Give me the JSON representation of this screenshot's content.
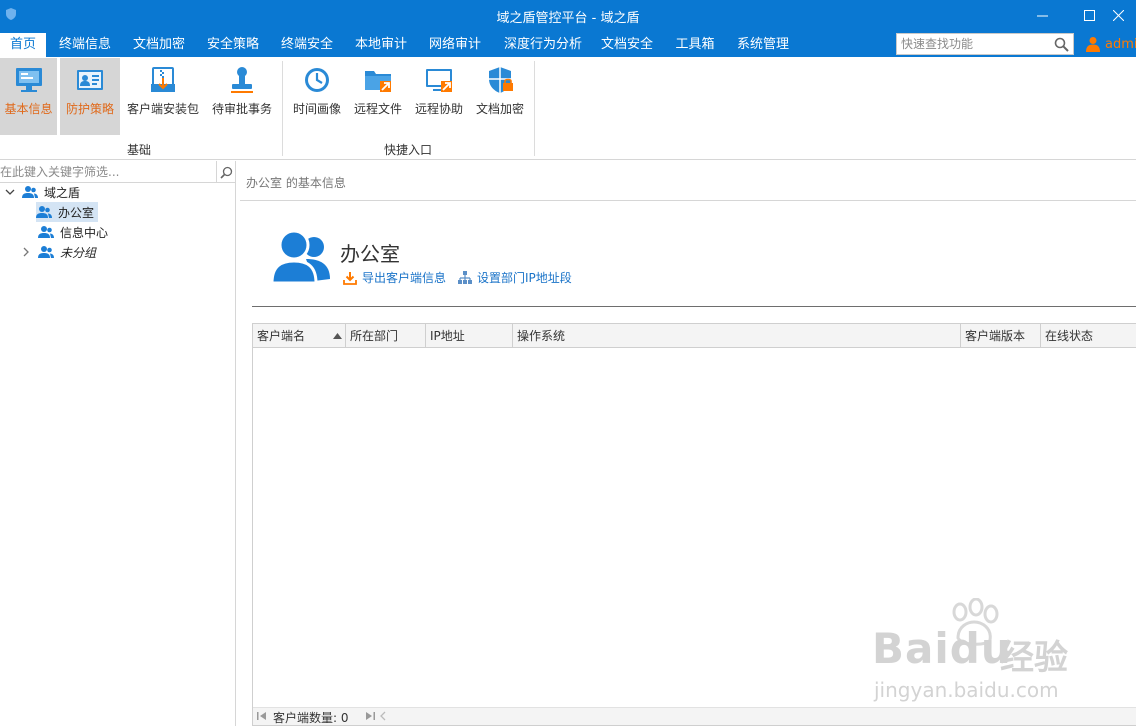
{
  "window": {
    "title": "域之盾管控平台 - 域之盾",
    "accent_color": "#0a78d2"
  },
  "menu": {
    "tabs": [
      "首页",
      "终端信息",
      "文档加密",
      "安全策略",
      "终端安全",
      "本地审计",
      "网络审计",
      "深度行为分析",
      "文档安全",
      "工具箱",
      "系统管理"
    ],
    "active_index": 0
  },
  "quick_search": {
    "placeholder": "快速查找功能"
  },
  "user": {
    "name": "admi"
  },
  "ribbon": {
    "groups": [
      {
        "label": "基础",
        "buttons": [
          {
            "label": "基本信息",
            "icon": "monitor-info-icon",
            "selected": true
          },
          {
            "label": "防护策略",
            "icon": "id-card-icon",
            "selected": true
          },
          {
            "label": "客户端安装包",
            "icon": "install-package-icon",
            "selected": false
          },
          {
            "label": "待审批事务",
            "icon": "approval-stamp-icon",
            "selected": false
          }
        ]
      },
      {
        "label": "快捷入口",
        "buttons": [
          {
            "label": "时间画像",
            "icon": "clock-icon",
            "selected": false
          },
          {
            "label": "远程文件",
            "icon": "remote-folder-icon",
            "selected": false
          },
          {
            "label": "远程协助",
            "icon": "remote-assist-icon",
            "selected": false
          },
          {
            "label": "文档加密",
            "icon": "shield-lock-icon",
            "selected": false
          }
        ]
      }
    ]
  },
  "tree": {
    "filter_placeholder": "在此键入关键字筛选...",
    "root": "域之盾",
    "children": [
      "办公室",
      "信息中心",
      "未分组"
    ],
    "selected": "办公室"
  },
  "main": {
    "breadcrumb": "办公室 的基本信息",
    "department_name": "办公室",
    "links": {
      "export": "导出客户端信息",
      "set_ip": "设置部门IP地址段"
    },
    "table": {
      "columns": [
        "客户端名",
        "所在部门",
        "IP地址",
        "操作系统",
        "客户端版本",
        "在线状态"
      ],
      "rows": [],
      "footer_count": "客户端数量: 0"
    }
  },
  "watermark": {
    "brand": "Bai",
    "brand2": "du",
    "cn": "经验",
    "url": "jingyan.baidu.com"
  }
}
